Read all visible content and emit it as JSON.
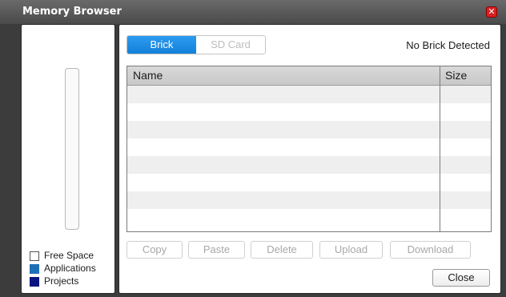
{
  "window": {
    "title": "Memory Browser"
  },
  "legend": [
    {
      "label": "Free Space",
      "color": "#ffffff"
    },
    {
      "label": "Applications",
      "color": "#1e6fb6"
    },
    {
      "label": "Projects",
      "color": "#0a1480"
    }
  ],
  "tabs": {
    "brick": "Brick",
    "sd_card": "SD Card",
    "selected": "Brick"
  },
  "status": "No Brick Detected",
  "table": {
    "columns": [
      "Name",
      "Size"
    ],
    "rows": []
  },
  "buttons": {
    "copy": "Copy",
    "paste": "Paste",
    "delete": "Delete",
    "upload": "Upload",
    "download": "Download",
    "close": "Close"
  },
  "icons": {
    "close": "close-icon"
  },
  "colors": {
    "tab_active": "#1a8ae4",
    "titlebar": "#555555"
  }
}
